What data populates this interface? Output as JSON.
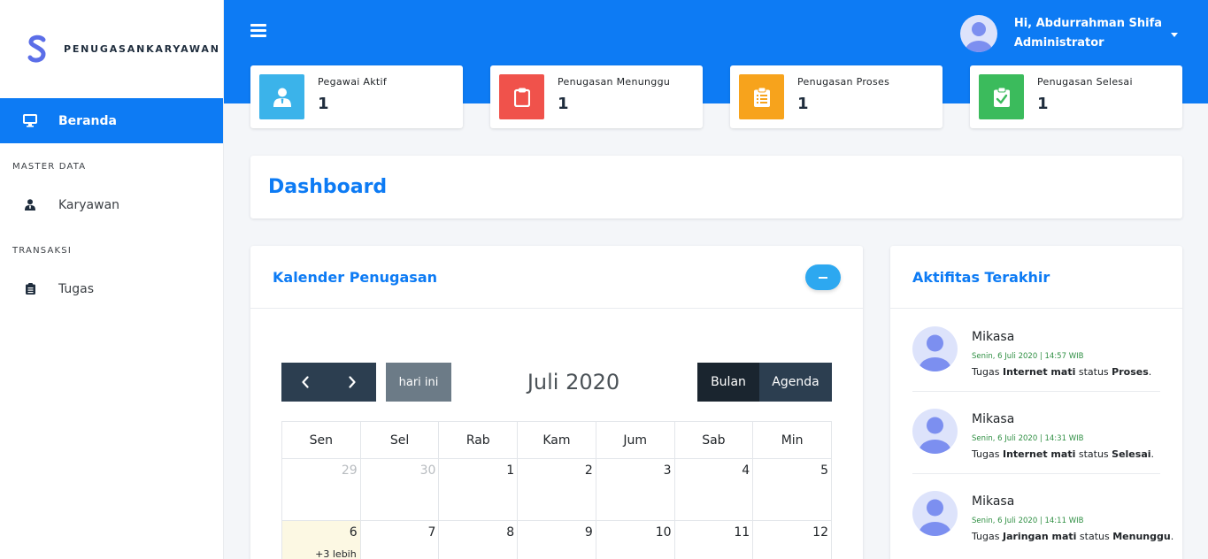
{
  "brand": {
    "name": "PENUGASANKARYAWAN",
    "logo_letter": "S"
  },
  "sidebar": {
    "active_item": {
      "label": "Beranda",
      "icon": "monitor-icon"
    },
    "sections": [
      {
        "title": "MASTER DATA",
        "items": [
          {
            "label": "Karyawan",
            "icon": "user-tie-icon"
          }
        ]
      },
      {
        "title": "TRANSAKSI",
        "items": [
          {
            "label": "Tugas",
            "icon": "clipboard-list-icon"
          }
        ]
      }
    ]
  },
  "header": {
    "greeting": "Hi, Abdurrahman Shifa",
    "role": "Administrator"
  },
  "stats": [
    {
      "label": "Pegawai Aktif",
      "value": "1",
      "color": "#3bb3ea",
      "icon": "user-tie-icon"
    },
    {
      "label": "Penugasan Menunggu",
      "value": "1",
      "color": "#f0524b",
      "icon": "clipboard-icon"
    },
    {
      "label": "Penugasan Proses",
      "value": "1",
      "color": "#f7a31c",
      "icon": "clipboard-list-icon"
    },
    {
      "label": "Penugasan Selesai",
      "value": "1",
      "color": "#3bbb5c",
      "icon": "clipboard-check-icon"
    }
  ],
  "page_title": "Dashboard",
  "calendar": {
    "title": "Kalender Penugasan",
    "today_label": "hari ini",
    "month": "Juli 2020",
    "views": [
      "Bulan",
      "Agenda"
    ],
    "weekdays": [
      "Sen",
      "Sel",
      "Rab",
      "Kam",
      "Jum",
      "Sab",
      "Min"
    ],
    "weeks": [
      [
        "29",
        "30",
        "1",
        "2",
        "3",
        "4",
        "5"
      ],
      [
        "6",
        "7",
        "8",
        "9",
        "10",
        "11",
        "12"
      ]
    ],
    "more_label": "+3 lebih"
  },
  "activity": {
    "title": "Aktifitas Terakhir",
    "items": [
      {
        "name": "Mikasa",
        "time": "Senin, 6 Juli 2020 | 14:57 WIB",
        "prefix": "Tugas ",
        "task": "Internet mati",
        "mid": " status ",
        "status": "Proses",
        "suffix": "."
      },
      {
        "name": "Mikasa",
        "time": "Senin, 6 Juli 2020 | 14:31 WIB",
        "prefix": "Tugas ",
        "task": "Internet mati",
        "mid": " status ",
        "status": "Selesai",
        "suffix": "."
      },
      {
        "name": "Mikasa",
        "time": "Senin, 6 Juli 2020 | 14:11 WIB",
        "prefix": "Tugas ",
        "task": "Jaringan mati",
        "mid": " status ",
        "status": "Menunggu",
        "suffix": "."
      }
    ]
  }
}
